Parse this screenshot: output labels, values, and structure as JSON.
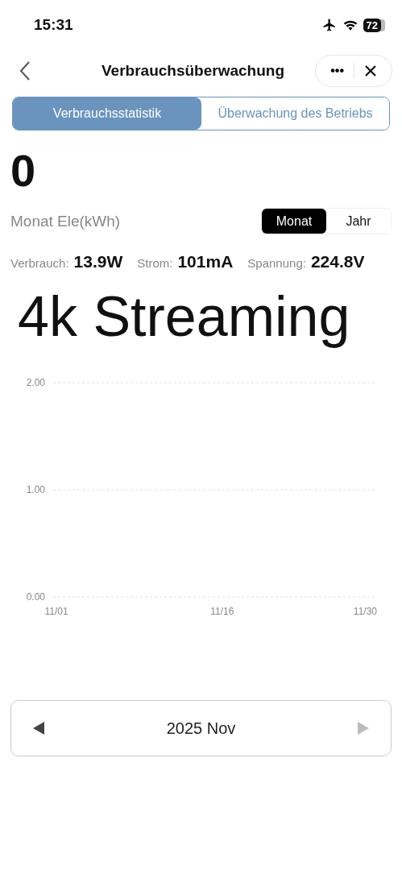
{
  "status_bar": {
    "time": "15:31",
    "battery": "72"
  },
  "nav": {
    "title": "Verbrauchsüberwachung",
    "more": "•••"
  },
  "tabs": [
    {
      "label": "Verbrauchsstatistik",
      "selected": true
    },
    {
      "label": "Überwachung des Betriebs",
      "selected": false
    }
  ],
  "total": "0",
  "unit_label": "Monat Ele(kWh)",
  "period": [
    {
      "label": "Monat",
      "selected": true
    },
    {
      "label": "Jahr",
      "selected": false
    }
  ],
  "metrics": [
    {
      "label": "Verbrauch:",
      "value": "13.9W"
    },
    {
      "label": "Strom:",
      "value": "101mA"
    },
    {
      "label": "Spannung:",
      "value": "224.8V"
    }
  ],
  "mode": "4k Streaming",
  "chart_data": {
    "type": "line",
    "ylim": [
      0,
      2
    ],
    "yticks": [
      {
        "value": 2,
        "label": "2.00"
      },
      {
        "value": 1,
        "label": "1.00"
      },
      {
        "value": 0,
        "label": "0.00"
      }
    ],
    "categories": [
      "11/01",
      null,
      null,
      null,
      null,
      null,
      null,
      null,
      null,
      null,
      null,
      null,
      null,
      null,
      null,
      "11/16",
      null,
      null,
      null,
      null,
      null,
      null,
      null,
      null,
      null,
      null,
      null,
      null,
      null,
      "11/30"
    ]
  },
  "date_nav": {
    "label": "2025 Nov",
    "prev_disabled": false,
    "next_disabled": true
  }
}
